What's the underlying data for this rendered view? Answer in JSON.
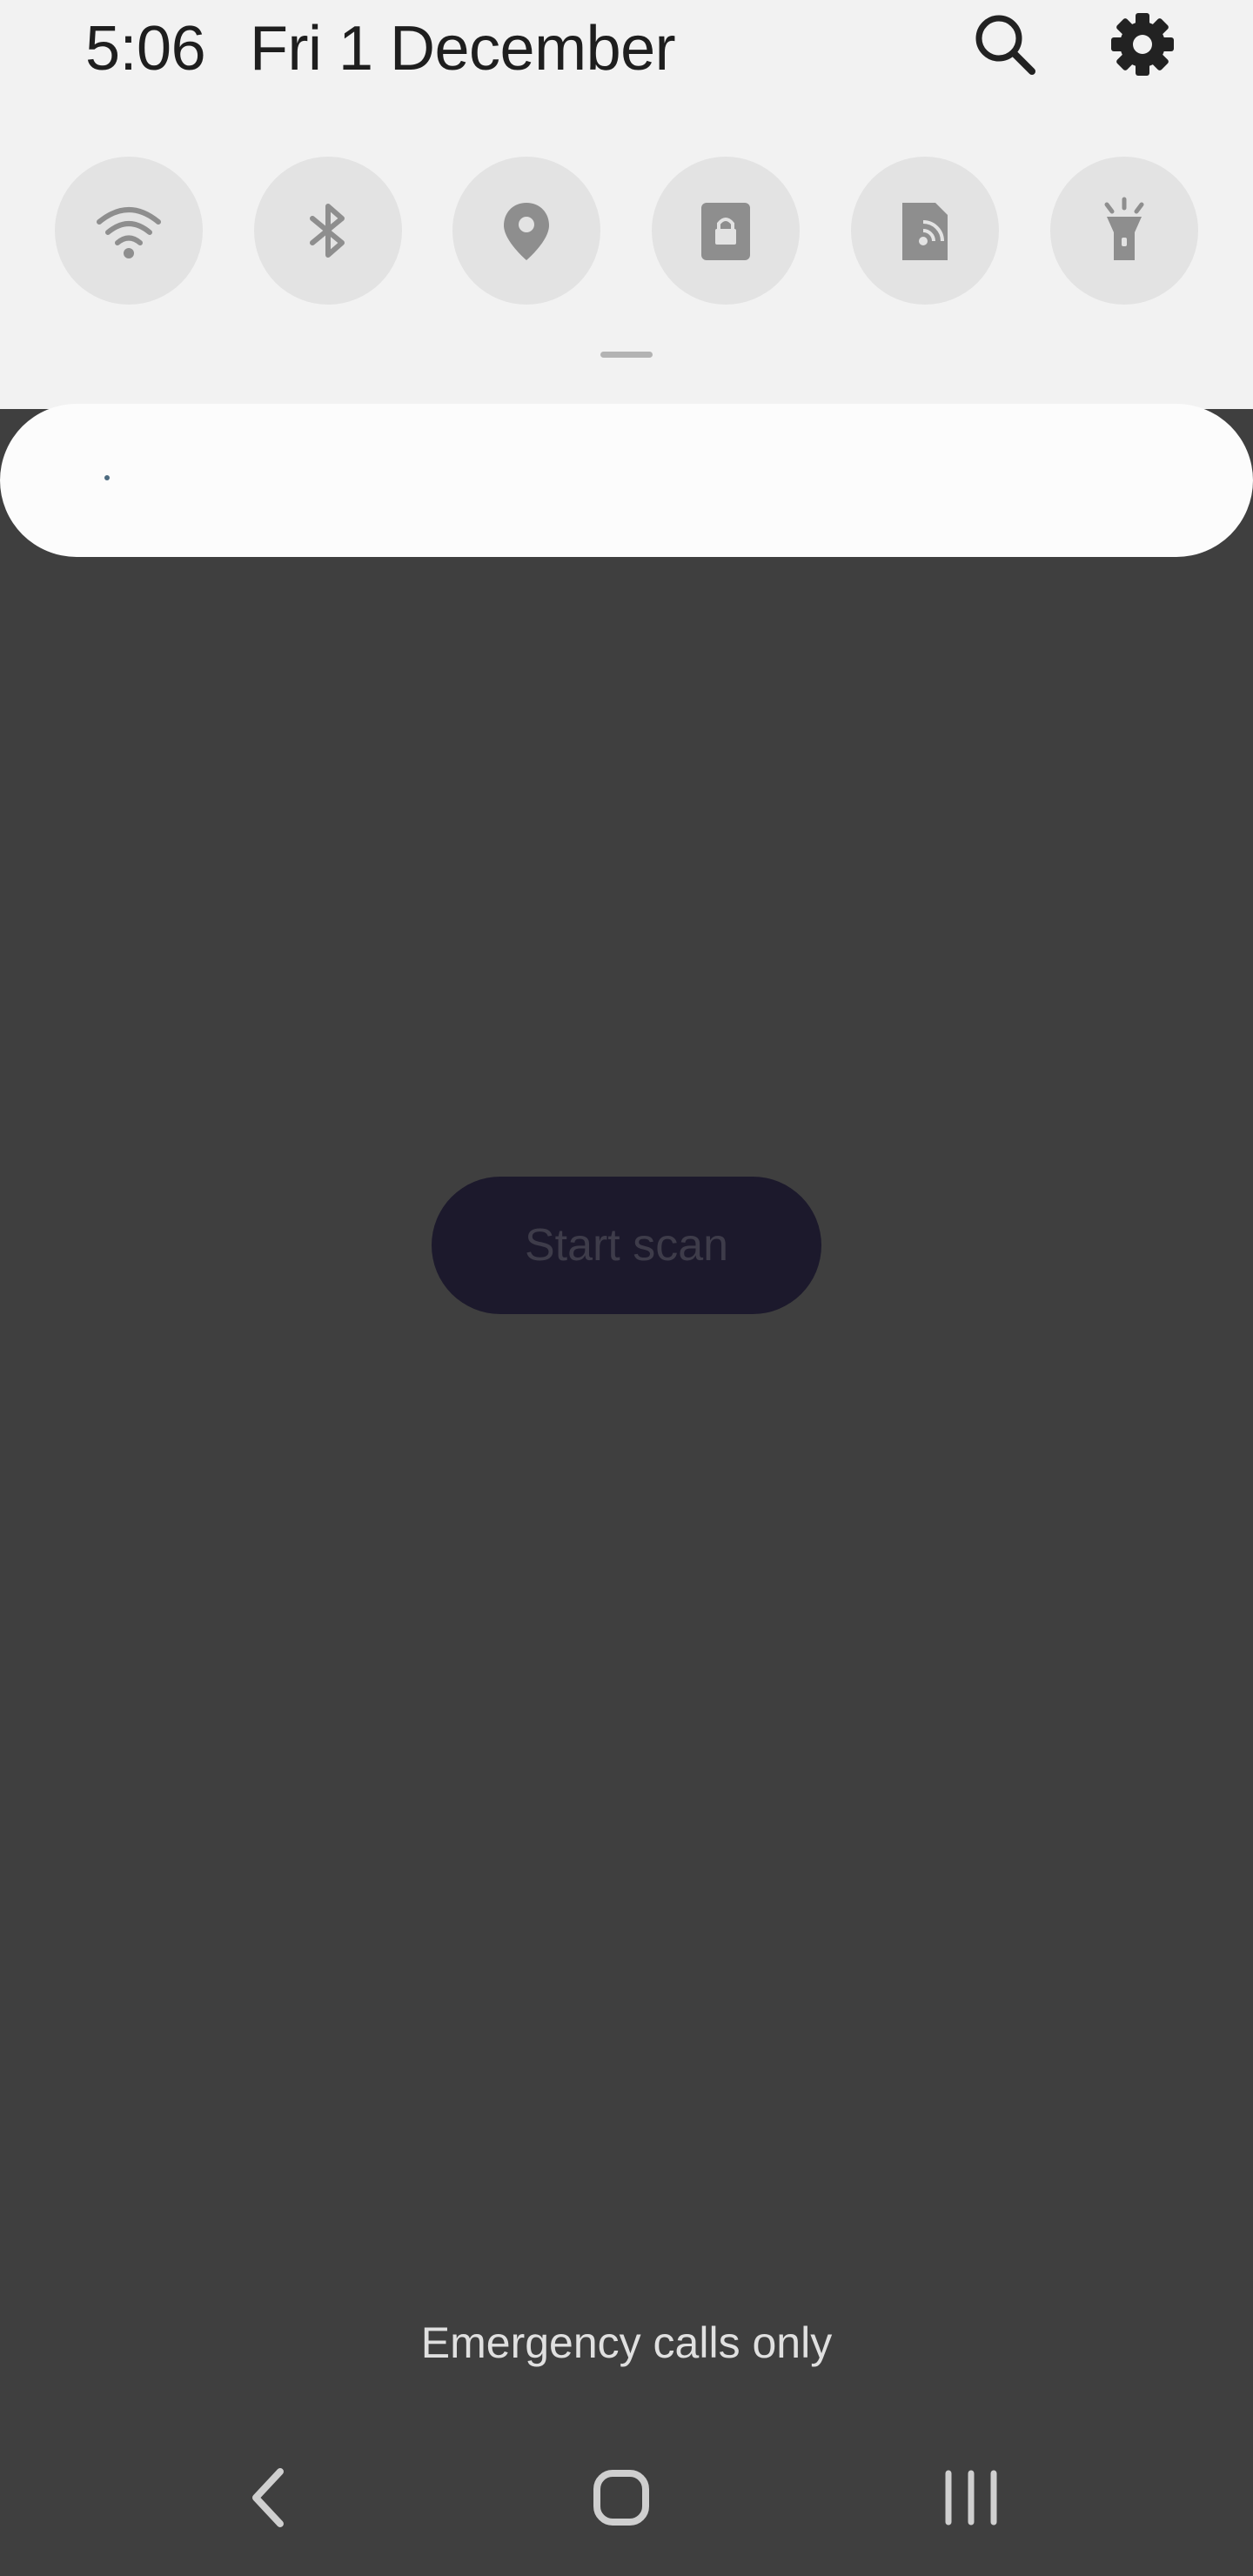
{
  "status_bar": {
    "time": "5:06",
    "date": "Fri 1 December",
    "search_icon": "search-icon",
    "settings_icon": "gear-icon"
  },
  "quick_settings": {
    "tiles": [
      {
        "name": "wifi",
        "icon": "wifi-icon"
      },
      {
        "name": "bluetooth",
        "icon": "bluetooth-icon"
      },
      {
        "name": "location",
        "icon": "location-icon"
      },
      {
        "name": "secure-folder",
        "icon": "lock-icon"
      },
      {
        "name": "nfc",
        "icon": "nfc-icon"
      },
      {
        "name": "flashlight",
        "icon": "flashlight-icon"
      }
    ],
    "tile_bg": "#e3e3e3",
    "icon_color": "#8e8e8e"
  },
  "app": {
    "start_scan_label": "Start scan"
  },
  "footer": {
    "emergency_text": "Emergency calls only"
  },
  "nav_bar": {
    "back_icon": "back-icon",
    "home_icon": "home-icon",
    "recents_icon": "recents-icon"
  },
  "colors": {
    "panel_bg": "#f2f2f2",
    "scrim_bg": "#3f3f3f",
    "button_bg": "#1c192c"
  }
}
